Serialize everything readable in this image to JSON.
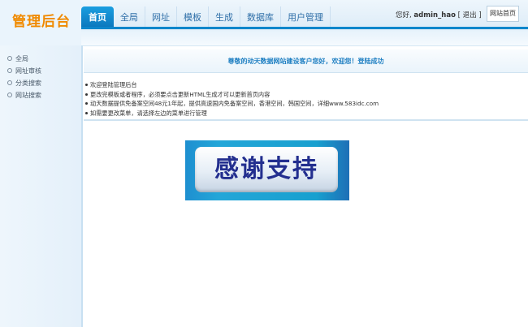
{
  "logo": {
    "text": "管理后台"
  },
  "nav": {
    "tabs": [
      {
        "label": "首页",
        "active": true
      },
      {
        "label": "全局"
      },
      {
        "label": "网址"
      },
      {
        "label": "模板"
      },
      {
        "label": "生成"
      },
      {
        "label": "数据库"
      },
      {
        "label": "用户管理"
      }
    ]
  },
  "header": {
    "greeting": "您好,",
    "username": "admin_hao",
    "logout": "[ 退出 ]",
    "home_button": "网站首页"
  },
  "sidebar": {
    "items": [
      {
        "label": "全局"
      },
      {
        "label": "网址审核"
      },
      {
        "label": "分类搜索"
      },
      {
        "label": "网站搜索"
      }
    ]
  },
  "main": {
    "welcome": "尊敬的动天数据网站建设客户您好，欢迎您！登陆成功",
    "info": [
      "欢迎登陆管理后台",
      "更改完模板或者程序，必须要点击更新HTML生成才可以更新首页内容",
      "动天数据提供免备案空间48元1年起，提供高速国内免备案空间，香港空间，韩国空间，详细www.583idc.com",
      "如需要更改菜单，请选择左边的菜单进行管理"
    ],
    "banner_text": "感谢支持"
  },
  "colors": {
    "accent": "#0d86cb",
    "logo": "#f08a00",
    "welcome_text": "#1e7fc2",
    "banner_text": "#232f8f"
  }
}
